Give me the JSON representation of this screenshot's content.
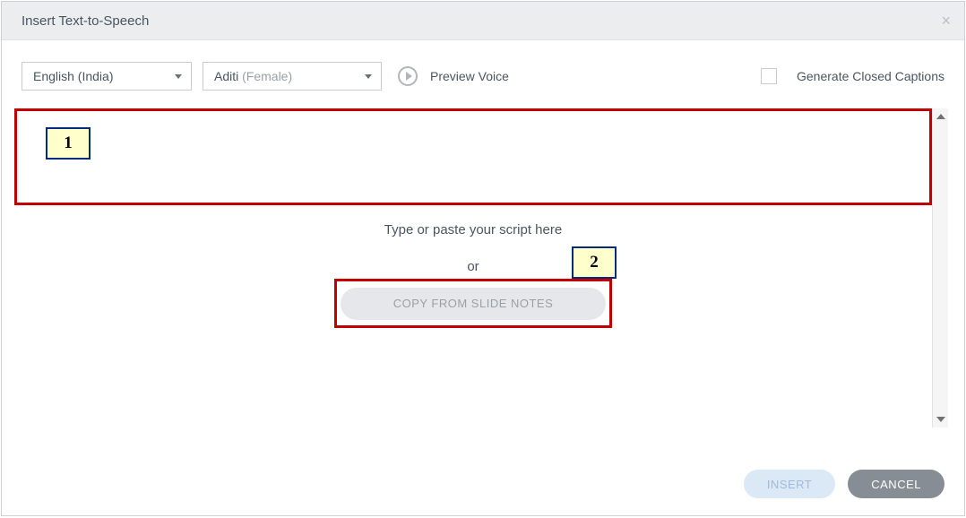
{
  "title": "Insert Text-to-Speech",
  "language": {
    "selected": "English (India)"
  },
  "voice": {
    "name": "Aditi",
    "extra": " (Female)"
  },
  "preview_label": "Preview Voice",
  "cc_label": "Generate Closed Captions",
  "placeholder": "Type or paste your script here",
  "or_label": "or",
  "copy_btn": "COPY FROM SLIDE NOTES",
  "insert_btn": "INSERT",
  "cancel_btn": "CANCEL",
  "callouts": {
    "one": "1",
    "two": "2"
  }
}
